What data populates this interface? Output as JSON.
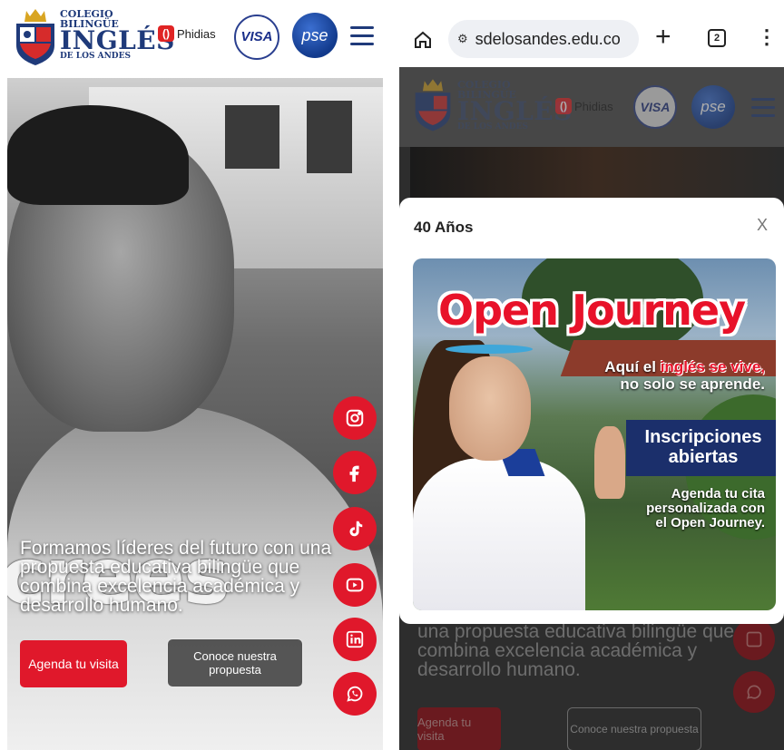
{
  "left_screen": {
    "header": {
      "school_line1": "COLEGIO",
      "school_line2": "BILINGÜE",
      "school_line3": "INGLÉS",
      "school_line4": "DE LOS ANDES",
      "phidias_label": "Phidias",
      "visa_label": "VISA",
      "pse_label": "pse"
    },
    "hero": {
      "big_word": "crees",
      "tagline": "Formamos líderes del futuro con una propuesta educativa bilingüe que combina excelencia académica y desarrollo humano.",
      "primary_button": "Agenda tu visita",
      "secondary_button": "Conoce nuestra propuesta"
    },
    "social_icons": [
      "instagram-icon",
      "facebook-icon",
      "tiktok-icon",
      "youtube-icon",
      "linkedin-icon",
      "whatsapp-icon"
    ]
  },
  "right_screen": {
    "browser": {
      "url": "sdelosandes.edu.co",
      "new_tab": "+",
      "tab_count": "2",
      "menu": "⋮"
    },
    "header": {
      "school_line1": "COLEGIO",
      "school_line2": "BILINGÜE",
      "school_line3": "INGLÉS",
      "school_line4": "DE LOS ANDES",
      "phidias_label": "Phidias",
      "visa_label": "VISA",
      "pse_label": "pse"
    },
    "modal": {
      "title": "40 Años",
      "close_label": "X",
      "promo": {
        "headline": "Open Journey",
        "sub_line1_prefix": "Aquí el ",
        "sub_line1_highlight": "inglés se vive,",
        "sub_line2": "no solo se aprende.",
        "badge": "Inscripciones abiertas",
        "cta_line1": "Agenda tu cita",
        "cta_line2": "personalizada con",
        "cta_line3": "el Open Journey."
      }
    },
    "behind": {
      "tagline": "una propuesta educativa bilingüe que combina excelencia académica y desarrollo humano.",
      "primary_button": "Agenda tu visita",
      "secondary_button": "Conoce nuestra propuesta"
    }
  },
  "colors": {
    "accent_red": "#e0182b",
    "school_blue": "#1f3a7a",
    "promo_navy": "#1b2f6b"
  }
}
